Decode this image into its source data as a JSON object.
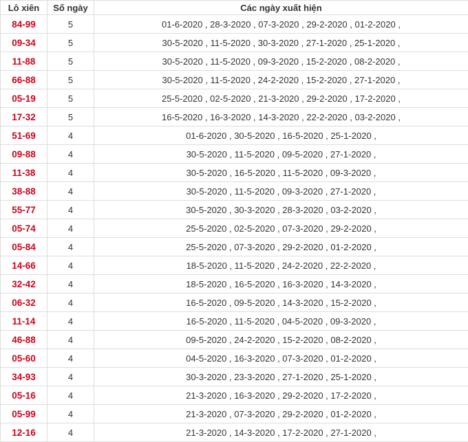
{
  "headers": {
    "pair": "Lô xiên",
    "count": "Số ngày",
    "dates": "Các ngày xuất hiện"
  },
  "rows": [
    {
      "pair": "84-99",
      "count": "5",
      "dates": "01-6-2020 , 28-3-2020 , 07-3-2020 , 29-2-2020 , 01-2-2020 ,"
    },
    {
      "pair": "09-34",
      "count": "5",
      "dates": "30-5-2020 , 11-5-2020 , 30-3-2020 , 27-1-2020 , 25-1-2020 ,"
    },
    {
      "pair": "11-88",
      "count": "5",
      "dates": "30-5-2020 , 11-5-2020 , 09-3-2020 , 15-2-2020 , 08-2-2020 ,"
    },
    {
      "pair": "66-88",
      "count": "5",
      "dates": "30-5-2020 , 11-5-2020 , 24-2-2020 , 15-2-2020 , 27-1-2020 ,"
    },
    {
      "pair": "05-19",
      "count": "5",
      "dates": "25-5-2020 , 02-5-2020 , 21-3-2020 , 29-2-2020 , 17-2-2020 ,"
    },
    {
      "pair": "17-32",
      "count": "5",
      "dates": "16-5-2020 , 16-3-2020 , 14-3-2020 , 22-2-2020 , 03-2-2020 ,"
    },
    {
      "pair": "51-69",
      "count": "4",
      "dates": "01-6-2020 , 30-5-2020 , 16-5-2020 , 25-1-2020 ,"
    },
    {
      "pair": "09-88",
      "count": "4",
      "dates": "30-5-2020 , 11-5-2020 , 09-5-2020 , 27-1-2020 ,"
    },
    {
      "pair": "11-38",
      "count": "4",
      "dates": "30-5-2020 , 16-5-2020 , 11-5-2020 , 09-3-2020 ,"
    },
    {
      "pair": "38-88",
      "count": "4",
      "dates": "30-5-2020 , 11-5-2020 , 09-3-2020 , 27-1-2020 ,"
    },
    {
      "pair": "55-77",
      "count": "4",
      "dates": "30-5-2020 , 30-3-2020 , 28-3-2020 , 03-2-2020 ,"
    },
    {
      "pair": "05-74",
      "count": "4",
      "dates": "25-5-2020 , 02-5-2020 , 07-3-2020 , 29-2-2020 ,"
    },
    {
      "pair": "05-84",
      "count": "4",
      "dates": "25-5-2020 , 07-3-2020 , 29-2-2020 , 01-2-2020 ,"
    },
    {
      "pair": "14-66",
      "count": "4",
      "dates": "18-5-2020 , 11-5-2020 , 24-2-2020 , 22-2-2020 ,"
    },
    {
      "pair": "32-42",
      "count": "4",
      "dates": "18-5-2020 , 16-5-2020 , 16-3-2020 , 14-3-2020 ,"
    },
    {
      "pair": "06-32",
      "count": "4",
      "dates": "16-5-2020 , 09-5-2020 , 14-3-2020 , 15-2-2020 ,"
    },
    {
      "pair": "11-14",
      "count": "4",
      "dates": "16-5-2020 , 11-5-2020 , 04-5-2020 , 09-3-2020 ,"
    },
    {
      "pair": "46-88",
      "count": "4",
      "dates": "09-5-2020 , 24-2-2020 , 15-2-2020 , 08-2-2020 ,"
    },
    {
      "pair": "05-60",
      "count": "4",
      "dates": "04-5-2020 , 16-3-2020 , 07-3-2020 , 01-2-2020 ,"
    },
    {
      "pair": "34-93",
      "count": "4",
      "dates": "30-3-2020 , 23-3-2020 , 27-1-2020 , 25-1-2020 ,"
    },
    {
      "pair": "05-16",
      "count": "4",
      "dates": "21-3-2020 , 16-3-2020 , 29-2-2020 , 17-2-2020 ,"
    },
    {
      "pair": "05-99",
      "count": "4",
      "dates": "21-3-2020 , 07-3-2020 , 29-2-2020 , 01-2-2020 ,"
    },
    {
      "pair": "12-16",
      "count": "4",
      "dates": "21-3-2020 , 14-3-2020 , 17-2-2020 , 27-1-2020 ,"
    }
  ]
}
